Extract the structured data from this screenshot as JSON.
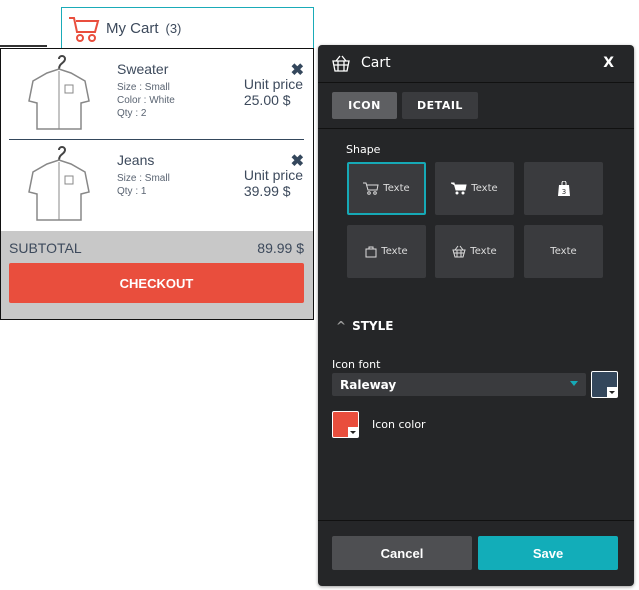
{
  "cart_widget": {
    "title": "My Cart",
    "count": "(3)",
    "icon": "cart-icon"
  },
  "items": [
    {
      "name": "Sweater",
      "meta": [
        "Size : Small",
        "Color : White",
        "Qty : 2"
      ],
      "price_label": "Unit price",
      "price": "25.00 $"
    },
    {
      "name": "Jeans",
      "meta": [
        "Size : Small",
        "Qty : 1"
      ],
      "price_label": "Unit price",
      "price": "39.99 $"
    }
  ],
  "subtotal": {
    "label": "SUBTOTAL",
    "value": "89.99 $"
  },
  "checkout_label": "CHECKOUT",
  "panel": {
    "title": "Cart",
    "close": "X",
    "tabs": [
      "ICON",
      "DETAIL"
    ],
    "shape_label": "Shape",
    "shapes": [
      {
        "icon": "cart-outline-icon",
        "text": "Texte",
        "selected": true
      },
      {
        "icon": "cart-solid-icon",
        "text": "Texte"
      },
      {
        "icon": "shopping-bag-count-icon",
        "text": "",
        "badge": "3"
      },
      {
        "icon": "bag-outline-icon",
        "text": "Texte"
      },
      {
        "icon": "basket-icon",
        "text": "Texte"
      },
      {
        "icon": "none",
        "text": "Texte"
      }
    ],
    "style_label": "STYLE",
    "icon_font_label": "Icon font",
    "icon_font_value": "Raleway",
    "font_color": "#34475c",
    "icon_color_label": "Icon color",
    "icon_color": "#e94e3d",
    "cancel": "Cancel",
    "save": "Save"
  }
}
